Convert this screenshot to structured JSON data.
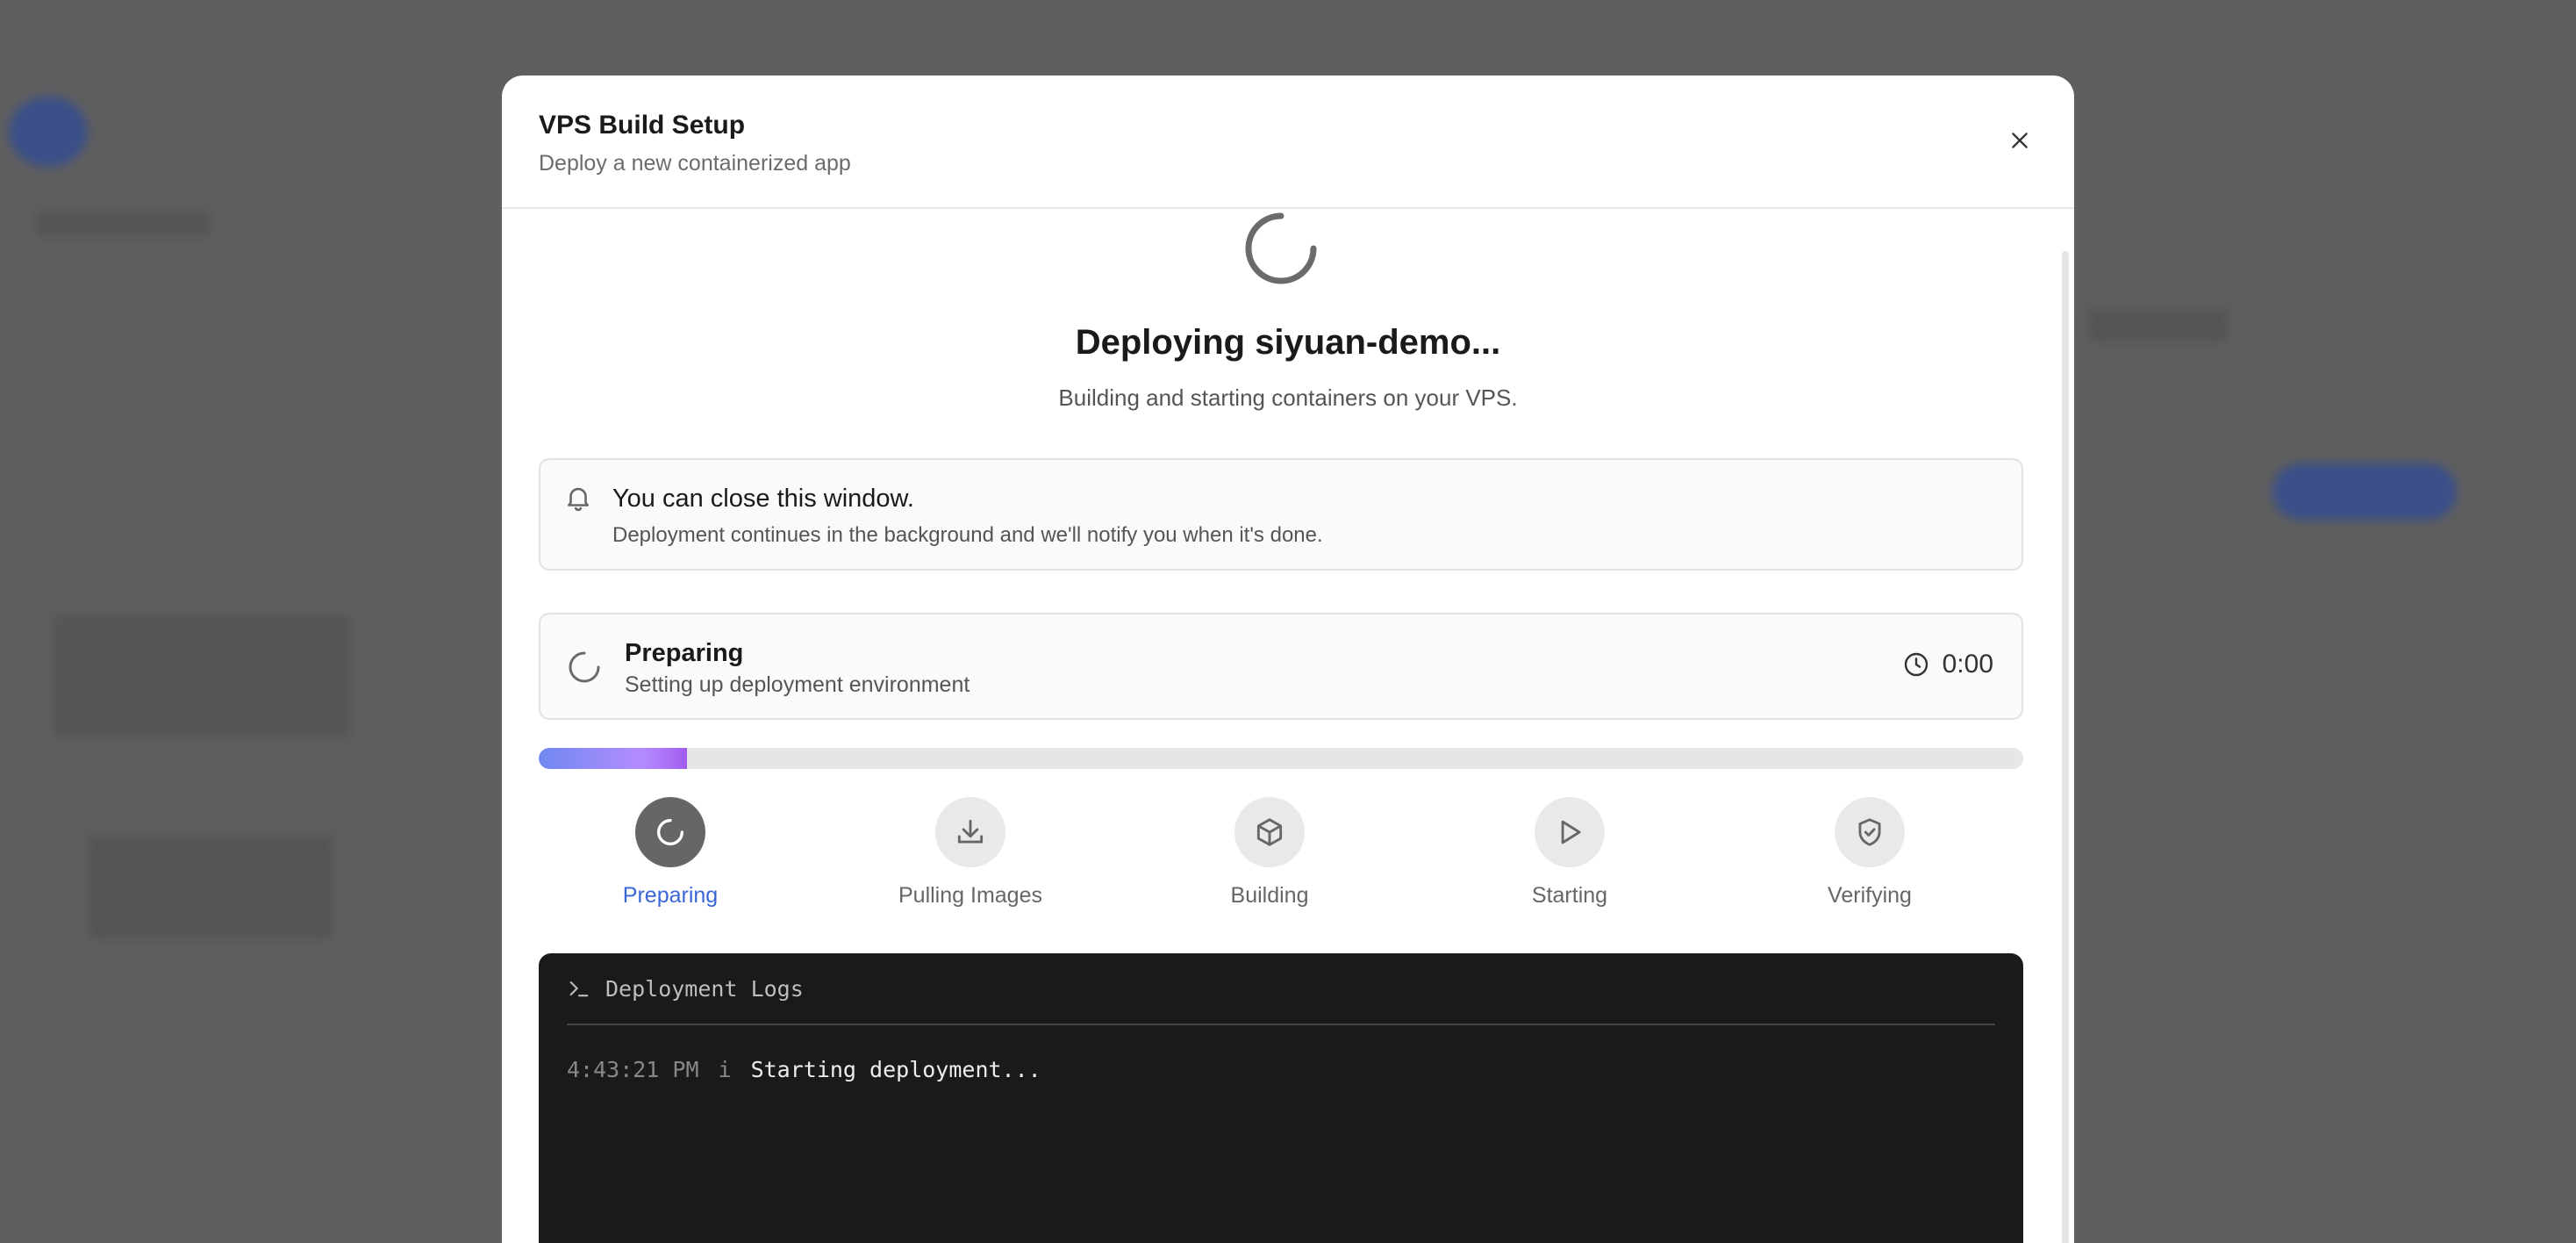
{
  "modal": {
    "title": "VPS Build Setup",
    "subtitle": "Deploy a new containerized app"
  },
  "deploy": {
    "title": "Deploying siyuan-demo...",
    "subtitle": "Building and starting containers on your VPS."
  },
  "notice": {
    "title": "You can close this window.",
    "text": "Deployment continues in the background and we'll notify you when it's done."
  },
  "status": {
    "title": "Preparing",
    "text": "Setting up deployment environment",
    "timer": "0:00"
  },
  "progress": {
    "fraction": 0.1
  },
  "steps": [
    {
      "label": "Preparing",
      "icon": "refresh-icon",
      "active": true
    },
    {
      "label": "Pulling Images",
      "icon": "download-icon",
      "active": false
    },
    {
      "label": "Building",
      "icon": "package-icon",
      "active": false
    },
    {
      "label": "Starting",
      "icon": "play-icon",
      "active": false
    },
    {
      "label": "Verifying",
      "icon": "shield-check-icon",
      "active": false
    }
  ],
  "logs": {
    "title": "Deployment Logs",
    "entries": [
      {
        "time": "4:43:21 PM",
        "level": "i",
        "message": "Starting deployment..."
      }
    ]
  },
  "colors": {
    "accent": "#3b66d8",
    "progress_start": "#6f88f0",
    "progress_end": "#a35cf0",
    "terminal_bg": "#1a1a1a"
  }
}
